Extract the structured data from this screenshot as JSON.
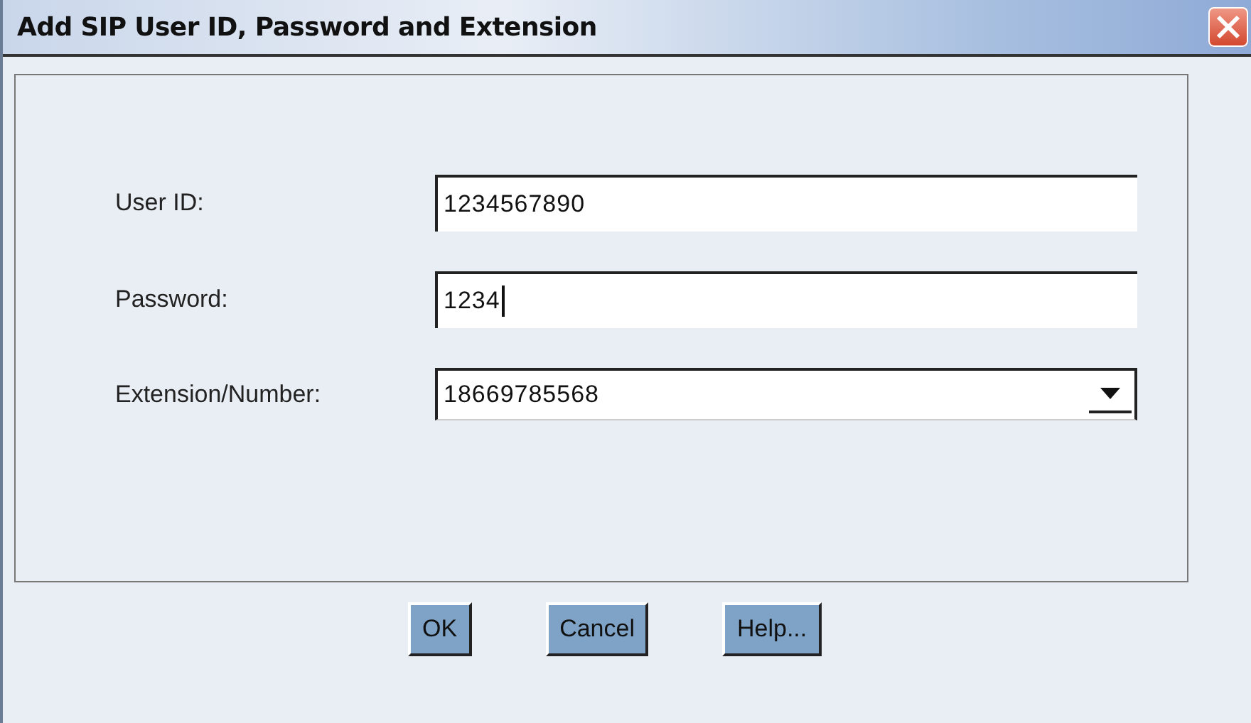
{
  "window": {
    "title": "Add SIP User ID, Password and Extension"
  },
  "fields": [
    {
      "kind": "text",
      "label": "User ID:",
      "value": "1234567890",
      "focused": false
    },
    {
      "kind": "text",
      "label": "Password:",
      "value": "1234",
      "focused": true
    },
    {
      "kind": "combo",
      "label": "Extension/Number:",
      "value": "18669785568",
      "focused": false
    }
  ],
  "buttons": [
    "OK",
    "Cancel",
    "Help..."
  ]
}
